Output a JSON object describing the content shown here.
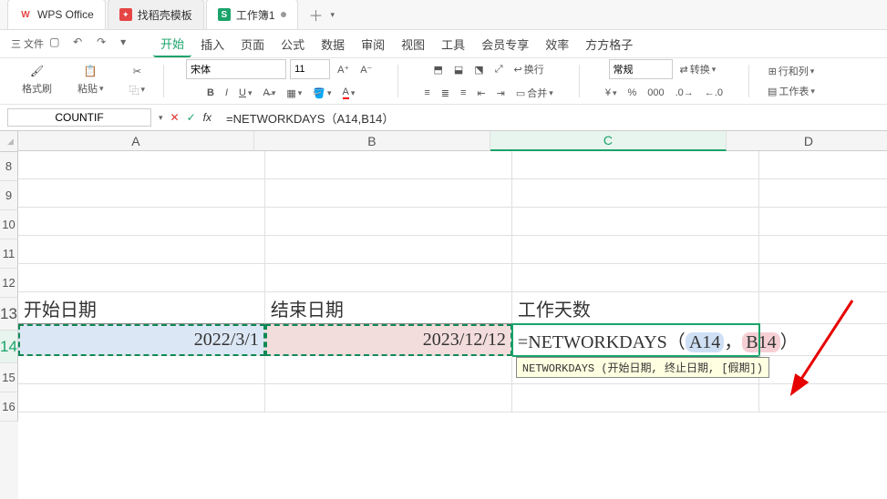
{
  "titlebar": {
    "app_name": "WPS Office",
    "tab_template": "找稻壳模板",
    "workbook": "工作簿1",
    "template_icon_color": "#e64545",
    "workbook_icon_bg": "#1aa36a",
    "workbook_icon_text": "S"
  },
  "menubar": {
    "file": "三 文件",
    "undo": "↶",
    "redo": "↷",
    "items": [
      "开始",
      "插入",
      "页面",
      "公式",
      "数据",
      "审阅",
      "视图",
      "工具",
      "会员专享",
      "效率",
      "方方格子"
    ],
    "active_index": 0
  },
  "ribbon": {
    "format_painter": "格式刷",
    "paste": "粘贴",
    "font_name": "宋体",
    "font_size": "11",
    "wrap": "换行",
    "merge": "合并",
    "number_format": "常规",
    "convert": "转换",
    "rowcol": "行和列",
    "sheet": "工作表"
  },
  "formulabar": {
    "namebox": "COUNTIF",
    "formula": "=NETWORKDAYS（A14,B14）"
  },
  "grid": {
    "col_labels": [
      "A",
      "B",
      "C",
      "D"
    ],
    "row_labels": [
      "8",
      "9",
      "10",
      "11",
      "12",
      "13",
      "14",
      "15",
      "16"
    ],
    "r13": {
      "a": "开始日期",
      "b": "结束日期",
      "c": "工作天数"
    },
    "r14": {
      "a": "2022/3/1",
      "b": "2023/12/12",
      "c_prefix": "=NETWORKDAYS（",
      "c_ref1": "A14",
      "c_comma": "，",
      "c_ref2": "B14",
      "c_suffix": "）"
    },
    "tooltip": "NETWORKDAYS (开始日期, 终止日期, [假期])"
  },
  "colors": {
    "accent": "#1aa36a",
    "arrow": "#e60000"
  },
  "chart_data": {
    "type": "table",
    "columns": [
      "开始日期",
      "结束日期",
      "工作天数"
    ],
    "rows": [
      {
        "开始日期": "2022/3/1",
        "结束日期": "2023/12/12",
        "工作天数": "=NETWORKDAYS(A14,B14)"
      }
    ]
  }
}
